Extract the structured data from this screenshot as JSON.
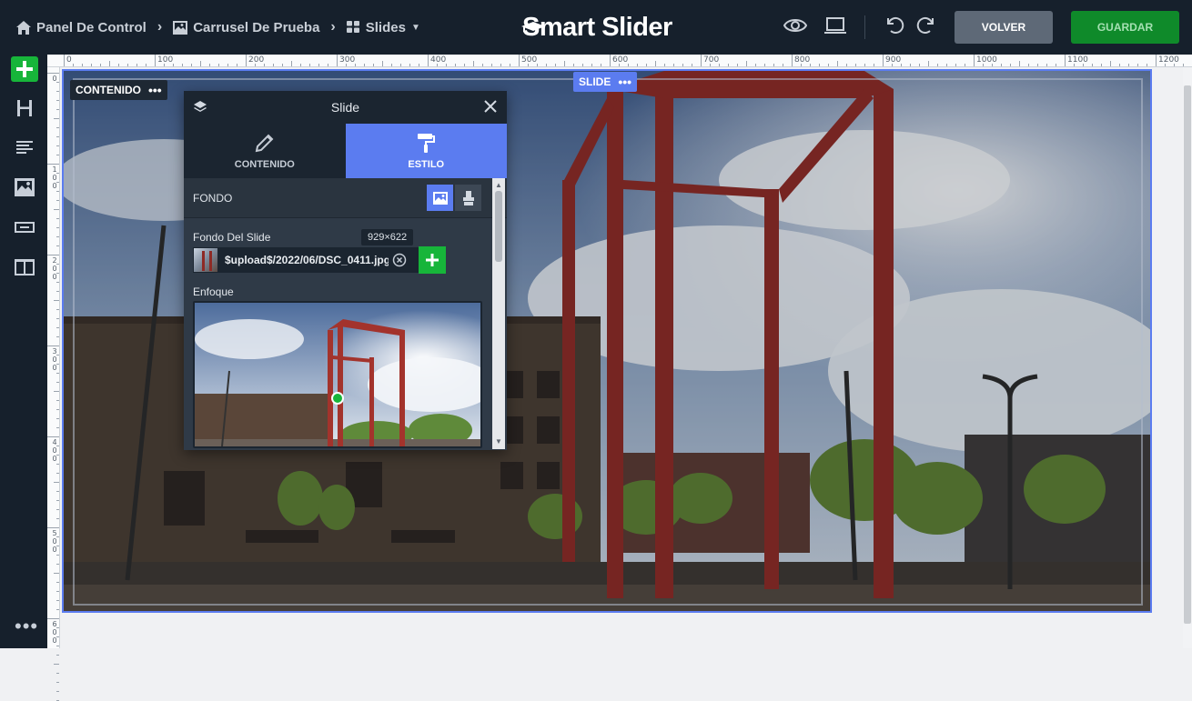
{
  "breadcrumbs": {
    "home": {
      "icon": "home-icon",
      "label": "Panel De Control"
    },
    "slider": {
      "icon": "image-icon",
      "label": "Carrusel De Prueba"
    },
    "slides": {
      "icon": "grid-icon",
      "label": "Slides"
    }
  },
  "logo": {
    "text": "Smart Slider"
  },
  "toolbar": {
    "preview_icon": "eye-icon",
    "device_icon": "laptop-icon",
    "undo_icon": "undo-icon",
    "redo_icon": "redo-icon",
    "volver_label": "VOLVER",
    "guardar_label": "GUARDAR"
  },
  "colors": {
    "topbar": "#16202c",
    "accent": "#5b7cf0",
    "green": "#17b53a",
    "save": "#0f8a2a"
  },
  "sidebar": {
    "items": [
      {
        "name": "add",
        "icon": "plus-icon"
      },
      {
        "name": "heading",
        "icon": "heading-icon"
      },
      {
        "name": "text",
        "icon": "text-icon"
      },
      {
        "name": "image",
        "icon": "image-icon"
      },
      {
        "name": "button",
        "icon": "button-icon"
      },
      {
        "name": "columns",
        "icon": "columns-icon"
      }
    ],
    "more": "•••"
  },
  "ruler": {
    "top_labels": [
      "0",
      "100",
      "200",
      "300",
      "400",
      "500",
      "600",
      "700",
      "800",
      "900",
      "1000",
      "1100",
      "1200"
    ],
    "left_labels": [
      "0",
      "100",
      "200",
      "300",
      "400",
      "500",
      "600"
    ]
  },
  "canvas": {
    "content_badge": "CONTENIDO",
    "slide_badge": "SLIDE",
    "badge_menu": "•••"
  },
  "panel": {
    "title": "Slide",
    "tabs": [
      {
        "label": "CONTENIDO",
        "icon": "pencil-icon",
        "active": false
      },
      {
        "label": "ESTILO",
        "icon": "paint-roller-icon",
        "active": true
      }
    ],
    "section": "FONDO",
    "fondo_label": "Fondo Del Slide",
    "image_size": "929×622",
    "file_value": "$upload$/2022/06/DSC_0411.jpg",
    "focus_label": "Enfoque"
  }
}
